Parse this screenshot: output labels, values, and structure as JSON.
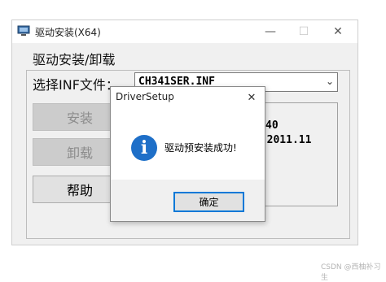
{
  "window": {
    "title": "驱动安装(X64)",
    "minimize_glyph": "—",
    "maximize_glyph": "☐",
    "close_glyph": "✕"
  },
  "main": {
    "group_label": "驱动安装/卸载",
    "select_label": "选择INF文件：",
    "selected_inf": "CH341SER.INF",
    "info_line_1": "40",
    "info_line_2": "3.2011.11",
    "buttons": {
      "install": "安装",
      "uninstall": "卸载",
      "help": "帮助"
    }
  },
  "dialog": {
    "title": "DriverSetup",
    "close_glyph": "✕",
    "icon": "info-icon",
    "message": "驱动预安装成功!",
    "ok_label": "确定"
  },
  "watermark": "CSDN @西柚补习生",
  "colors": {
    "accent": "#0078d7",
    "info_icon": "#1e6fc8"
  }
}
